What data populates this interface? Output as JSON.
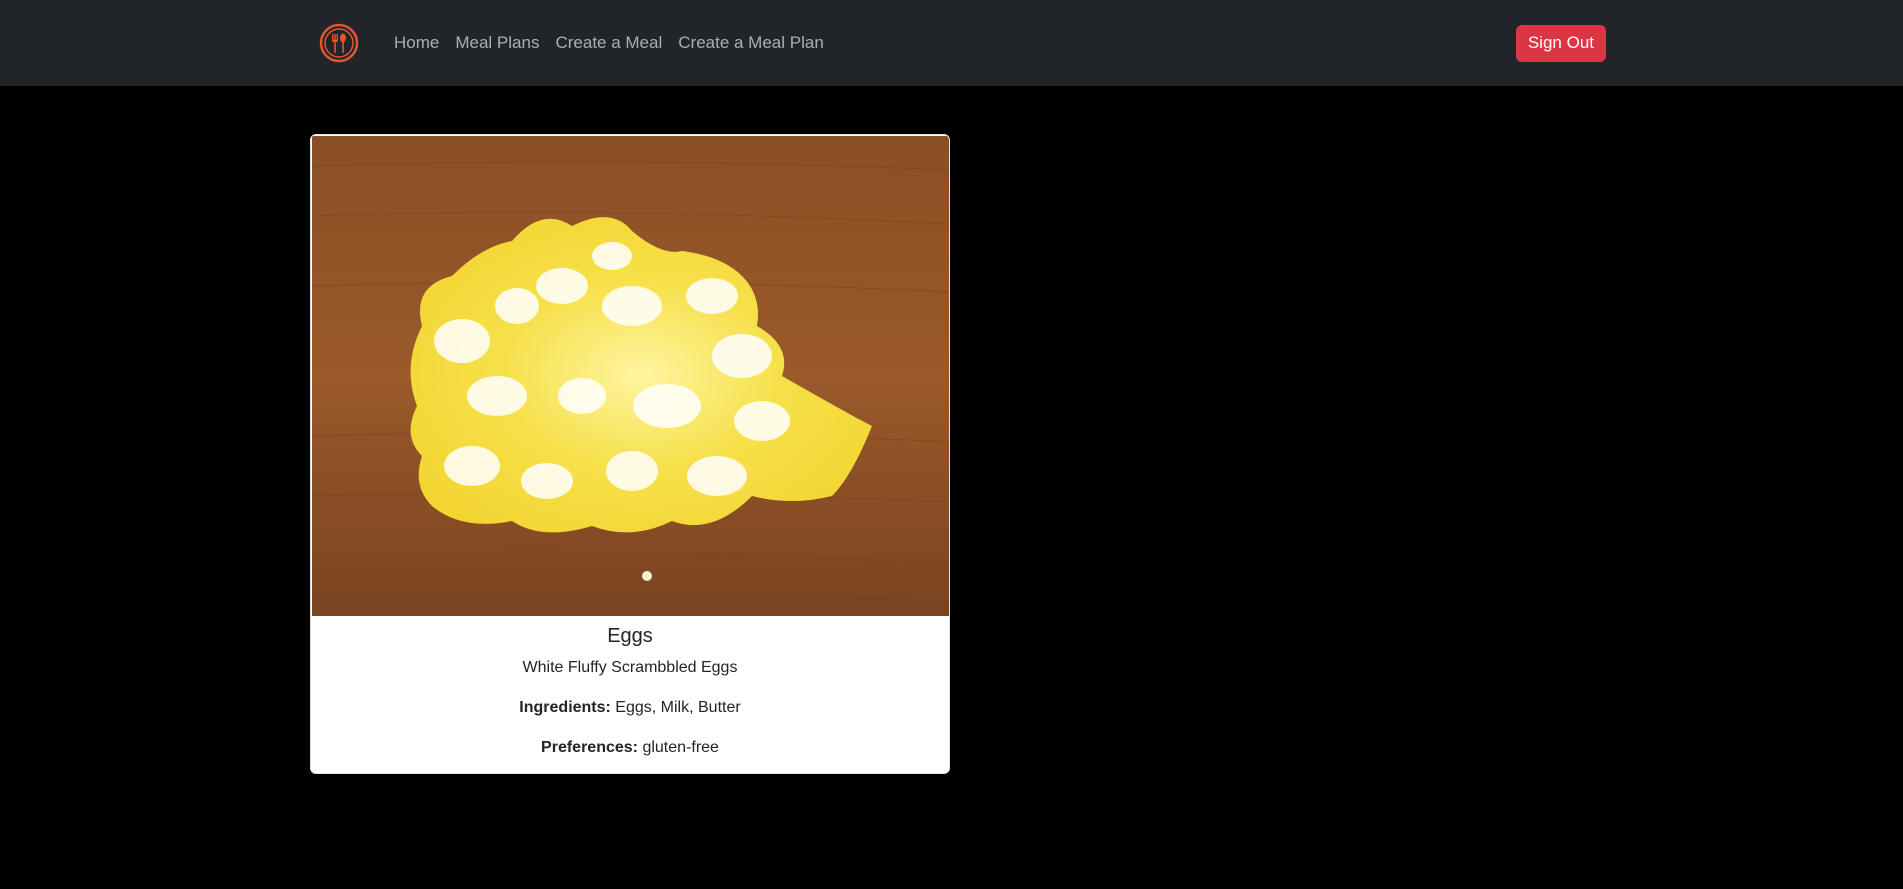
{
  "nav": {
    "links": [
      "Home",
      "Meal Plans",
      "Create a Meal",
      "Create a Meal Plan"
    ],
    "signout_label": "Sign Out"
  },
  "card": {
    "title": "Eggs",
    "description": "White Fluffy Scrambbled Eggs",
    "ingredients_label": "Ingredients:",
    "ingredients_value": " Eggs, Milk, Butter",
    "preferences_label": "Preferences:",
    "preferences_value": " gluten-free"
  },
  "colors": {
    "navbar_bg": "#212529",
    "page_bg": "#000000",
    "accent": "#dc3545",
    "logo": "#e8542f"
  },
  "icons": {
    "logo": "fork-spoon-logo-icon"
  }
}
